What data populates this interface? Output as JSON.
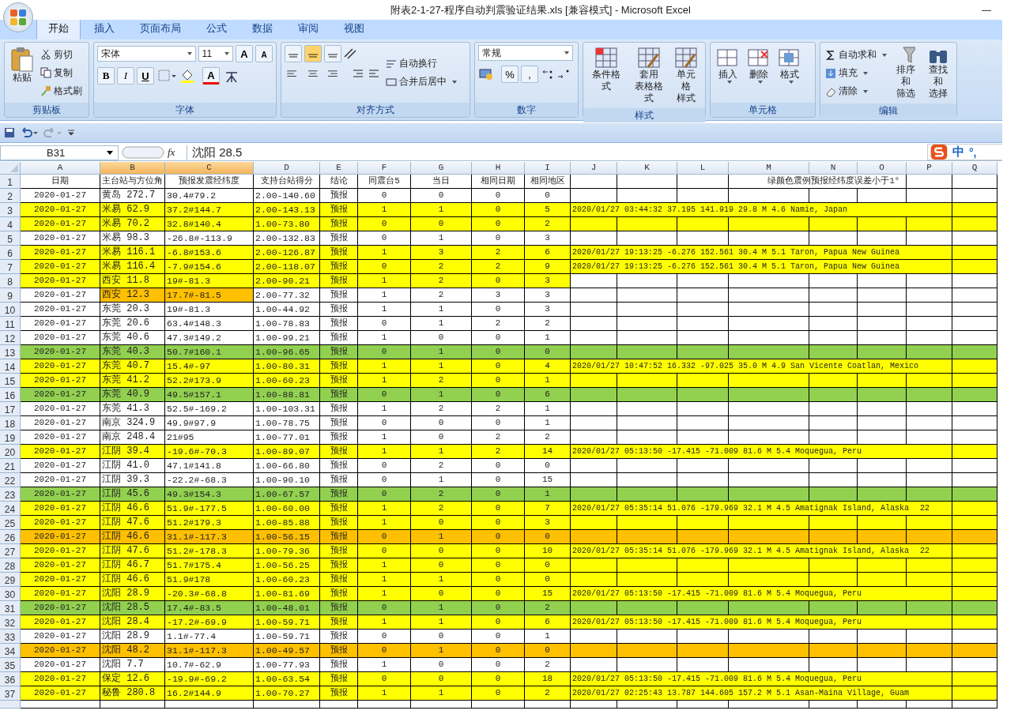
{
  "window": {
    "title": "附表2-1-27-程序自动判震验证结果.xls  [兼容模式] - Microsoft Excel",
    "minimize": "—"
  },
  "tabs": [
    {
      "label": "开始",
      "selected": true
    },
    {
      "label": "插入",
      "selected": false
    },
    {
      "label": "页面布局",
      "selected": false
    },
    {
      "label": "公式",
      "selected": false
    },
    {
      "label": "数据",
      "selected": false
    },
    {
      "label": "审阅",
      "selected": false
    },
    {
      "label": "视图",
      "selected": false
    }
  ],
  "ribbon": {
    "clipboard": {
      "label": "剪贴板",
      "paste": "粘贴",
      "small": [
        "剪切",
        "复制",
        "格式刷"
      ]
    },
    "font": {
      "label": "字体",
      "face": "宋体",
      "size": "11",
      "grow": "A",
      "shrink": "A",
      "styles": [
        "B",
        "I",
        "U"
      ],
      "color_letter": "A"
    },
    "alignment": {
      "label": "对齐方式",
      "valign": [
        {
          "selected": false
        },
        {
          "selected": true
        },
        {
          "selected": false
        }
      ],
      "wrap": "自动换行",
      "merge": "合并后居中"
    },
    "number": {
      "label": "数字",
      "format": "常规",
      "percent": "%",
      "comma": ","
    },
    "styles": {
      "label": "样式",
      "buttons": [
        [
          "条件格式"
        ],
        [
          "套用",
          "表格格式"
        ],
        [
          "单元格",
          "样式"
        ]
      ]
    },
    "cells": {
      "label": "单元格",
      "buttons": [
        "插入",
        "删除",
        "格式"
      ]
    },
    "editing": {
      "label": "编辑",
      "small": [
        "自动求和",
        "填充",
        "清除"
      ],
      "big": [
        [
          "排序和",
          "筛选"
        ],
        [
          "查找和",
          "选择"
        ]
      ]
    }
  },
  "formula_bar": {
    "name_box": "B31",
    "fx": "fx",
    "value": "沈阳 28.5"
  },
  "ime": {
    "mode": "中",
    "punct": "°,"
  },
  "columns": [
    {
      "letter": "A",
      "selected": false
    },
    {
      "letter": "B",
      "selected": true
    },
    {
      "letter": "C",
      "selected": true
    },
    {
      "letter": "D",
      "selected": false
    },
    {
      "letter": "E",
      "selected": false
    },
    {
      "letter": "F",
      "selected": false
    },
    {
      "letter": "G",
      "selected": false
    },
    {
      "letter": "H",
      "selected": false
    },
    {
      "letter": "I",
      "selected": false
    },
    {
      "letter": "J",
      "selected": false
    },
    {
      "letter": "K",
      "selected": false
    },
    {
      "letter": "L",
      "selected": false
    },
    {
      "letter": "M",
      "selected": false
    },
    {
      "letter": "N",
      "selected": false
    },
    {
      "letter": "O",
      "selected": false
    },
    {
      "letter": "P",
      "selected": false
    },
    {
      "letter": "Q",
      "selected": false
    }
  ],
  "header_row": {
    "num": "1",
    "cells": [
      "日期",
      "主台站与方位角",
      "预报发震经纬度",
      "支持台站得分",
      "结论",
      "同震台5",
      "当日",
      "相同日期",
      "相同地区"
    ],
    "note": "绿颜色震例预报经纬度误差小于1°"
  },
  "rows": [
    {
      "num": "2",
      "color": "#ffffff",
      "wide": false,
      "cells": [
        "2020-01-27",
        "黄岛 272.7",
        "30.4#79.2",
        "2.00-140.60",
        "预报",
        "0",
        "0",
        "0",
        "0"
      ]
    },
    {
      "num": "3",
      "color": "#ffff00",
      "wide": true,
      "cells": [
        "2020-01-27",
        "米易 62.9",
        "37.2#144.7",
        "2.00-143.13",
        "预报",
        "1",
        "1",
        "0",
        "5"
      ],
      "note": "2020/01/27 03:44:32 37.195 141.919 29.8 M 4.6 Namie, Japan"
    },
    {
      "num": "4",
      "color": "#ffff00",
      "wide": true,
      "cells": [
        "2020-01-27",
        "米易 70.2",
        "32.8#140.4",
        "1.00-73.80",
        "预报",
        "0",
        "0",
        "0",
        "2"
      ]
    },
    {
      "num": "5",
      "color": "#ffffff",
      "wide": false,
      "cells": [
        "2020-01-27",
        "米易 98.3",
        "-26.8#-113.9",
        "2.00-132.83",
        "预报",
        "0",
        "1",
        "0",
        "3"
      ]
    },
    {
      "num": "6",
      "color": "#ffff00",
      "wide": true,
      "cells": [
        "2020-01-27",
        "米易 116.1",
        "-6.8#153.6",
        "2.00-126.87",
        "预报",
        "1",
        "3",
        "2",
        "6"
      ],
      "note": "2020/01/27 19:13:25 -6.276 152.561 30.4 M 5.1 Taron, Papua New Guinea"
    },
    {
      "num": "7",
      "color": "#ffff00",
      "wide": true,
      "cells": [
        "2020-01-27",
        "米易 116.4",
        "-7.9#154.6",
        "2.00-118.07",
        "预报",
        "0",
        "2",
        "2",
        "9"
      ],
      "note": "2020/01/27 19:13:25 -6.276 152.561 30.4 M 5.1 Taron, Papua New Guinea"
    },
    {
      "num": "8",
      "color": "#ffff00",
      "wide": false,
      "cells": [
        "2020-01-27",
        "西安 11.8",
        "19#-81.3",
        "2.00-90.21",
        "预报",
        "1",
        "2",
        "0",
        "3"
      ]
    },
    {
      "num": "9",
      "color": "#ffffff",
      "wide": false,
      "cells": [
        "2020-01-27",
        {
          "text": "西安 12.3",
          "color": "#ffc000"
        },
        {
          "text": "17.7#-81.5",
          "color": "#ffc000"
        },
        "2.00-77.32",
        "预报",
        "1",
        "2",
        "3",
        "3"
      ]
    },
    {
      "num": "10",
      "color": "#ffffff",
      "wide": false,
      "cells": [
        "2020-01-27",
        "东莞 20.3",
        "19#-81.3",
        "1.00-44.92",
        "预报",
        "1",
        "1",
        "0",
        "3"
      ]
    },
    {
      "num": "11",
      "color": "#ffffff",
      "wide": false,
      "cells": [
        "2020-01-27",
        "东莞 20.6",
        "63.4#148.3",
        "1.00-78.83",
        "预报",
        "0",
        "1",
        "2",
        "2"
      ]
    },
    {
      "num": "12",
      "color": "#ffffff",
      "wide": false,
      "cells": [
        "2020-01-27",
        "东莞 40.6",
        "47.3#149.2",
        "1.00-99.21",
        "预报",
        "1",
        "0",
        "0",
        "1"
      ]
    },
    {
      "num": "13",
      "color": "#92d050",
      "wide": true,
      "cells": [
        "2020-01-27",
        "东莞 40.3",
        "50.7#160.1",
        "1.00-96.65",
        "预报",
        "0",
        "1",
        "0",
        "0"
      ]
    },
    {
      "num": "14",
      "color": "#ffff00",
      "wide": true,
      "cells": [
        "2020-01-27",
        "东莞 40.7",
        "15.4#-97",
        "1.00-80.31",
        "预报",
        "1",
        "1",
        "0",
        "4"
      ],
      "note": "2020/01/27 10:47:52 16.332 -97.025 35.0 M 4.9 San Vicente Coatlan, Mexico"
    },
    {
      "num": "15",
      "color": "#ffff00",
      "wide": true,
      "cells": [
        "2020-01-27",
        "东莞 41.2",
        "52.2#173.9",
        "1.00-60.23",
        "预报",
        "1",
        "2",
        "0",
        "1"
      ]
    },
    {
      "num": "16",
      "color": "#92d050",
      "wide": true,
      "cells": [
        "2020-01-27",
        "东莞 40.9",
        "49.5#157.1",
        "1.00-88.81",
        "预报",
        "0",
        "1",
        "0",
        "6"
      ]
    },
    {
      "num": "17",
      "color": "#ffffff",
      "wide": false,
      "cells": [
        "2020-01-27",
        "东莞 41.3",
        "52.5#-169.2",
        "1.00-103.31",
        "预报",
        "1",
        "2",
        "2",
        "1"
      ]
    },
    {
      "num": "18",
      "color": "#ffffff",
      "wide": false,
      "cells": [
        "2020-01-27",
        "南京 324.9",
        "49.9#97.9",
        "1.00-78.75",
        "预报",
        "0",
        "0",
        "0",
        "1"
      ]
    },
    {
      "num": "19",
      "color": "#ffffff",
      "wide": false,
      "cells": [
        "2020-01-27",
        "南京 248.4",
        "21#95",
        "1.00-77.01",
        "预报",
        "1",
        "0",
        "2",
        "2"
      ]
    },
    {
      "num": "20",
      "color": "#ffff00",
      "wide": true,
      "cells": [
        "2020-01-27",
        "江阴 39.4",
        "-19.6#-70.3",
        "1.00-89.07",
        "预报",
        "1",
        "1",
        "2",
        "14"
      ],
      "note": "2020/01/27 05:13:50 -17.415 -71.009 81.6 M 5.4 Moquegua, Peru"
    },
    {
      "num": "21",
      "color": "#ffffff",
      "wide": false,
      "cells": [
        "2020-01-27",
        "江阴 41.0",
        "47.1#141.8",
        "1.00-66.80",
        "预报",
        "0",
        "2",
        "0",
        "0"
      ]
    },
    {
      "num": "22",
      "color": "#ffffff",
      "wide": false,
      "cells": [
        "2020-01-27",
        "江阴 39.3",
        "-22.2#-68.3",
        "1.00-90.10",
        "预报",
        "0",
        "1",
        "0",
        "15"
      ]
    },
    {
      "num": "23",
      "color": "#92d050",
      "wide": true,
      "cells": [
        "2020-01-27",
        "江阴 45.6",
        "49.3#154.3",
        "1.00-67.57",
        "预报",
        "0",
        "2",
        "0",
        "1"
      ]
    },
    {
      "num": "24",
      "color": "#ffff00",
      "wide": true,
      "cells": [
        "2020-01-27",
        "江阴 46.6",
        "51.9#-177.5",
        "1.00-60.00",
        "预报",
        "1",
        "2",
        "0",
        "7"
      ],
      "note": "2020/01/27 05:35:14 51.076 -179.969 32.1 M 4.5 Amatignak Island, Alaska",
      "extra": "22"
    },
    {
      "num": "25",
      "color": "#ffff00",
      "wide": true,
      "cells": [
        "2020-01-27",
        "江阴 47.6",
        "51.2#179.3",
        "1.00-85.88",
        "预报",
        "1",
        "0",
        "0",
        "3"
      ]
    },
    {
      "num": "26",
      "color": "#ffc000",
      "wide": true,
      "cells": [
        "2020-01-27",
        "江阴 46.6",
        "31.1#-117.3",
        "1.00-56.15",
        "预报",
        "0",
        "1",
        "0",
        "0"
      ]
    },
    {
      "num": "27",
      "color": "#ffff00",
      "wide": true,
      "cells": [
        "2020-01-27",
        "江阴 47.6",
        "51.2#-178.3",
        "1.00-79.36",
        "预报",
        "0",
        "0",
        "0",
        "10"
      ],
      "note": "2020/01/27 05:35:14 51.076 -179.969 32.1 M 4.5 Amatignak Island, Alaska",
      "extra": "22"
    },
    {
      "num": "28",
      "color": "#ffff00",
      "wide": true,
      "cells": [
        "2020-01-27",
        "江阴 46.7",
        "51.7#175.4",
        "1.00-56.25",
        "预报",
        "1",
        "0",
        "0",
        "0"
      ]
    },
    {
      "num": "29",
      "color": "#ffff00",
      "wide": true,
      "cells": [
        "2020-01-27",
        "江阴 46.6",
        "51.9#178",
        "1.00-60.23",
        "预报",
        "1",
        "1",
        "0",
        "0"
      ]
    },
    {
      "num": "30",
      "color": "#ffff00",
      "wide": true,
      "cells": [
        "2020-01-27",
        "沈阳 28.9",
        "-20.3#-68.8",
        "1.00-81.69",
        "预报",
        "1",
        "0",
        "0",
        "15"
      ],
      "note": "2020/01/27 05:13:50 -17.415 -71.009 81.6 M 5.4 Moquegua, Peru"
    },
    {
      "num": "31",
      "color": "#92d050",
      "wide": true,
      "cells": [
        "2020-01-27",
        "沈阳 28.5",
        "17.4#-83.5",
        "1.00-48.01",
        "预报",
        "0",
        "1",
        "0",
        "2"
      ]
    },
    {
      "num": "32",
      "color": "#ffff00",
      "wide": true,
      "cells": [
        "2020-01-27",
        "沈阳 28.4",
        "-17.2#-69.9",
        "1.00-59.71",
        "预报",
        "1",
        "1",
        "0",
        "6"
      ],
      "note": "2020/01/27 05:13:50 -17.415 -71.009 81.6 M 5.4 Moquegua, Peru"
    },
    {
      "num": "33",
      "color": "#ffffff",
      "wide": false,
      "cells": [
        "2020-01-27",
        "沈阳 28.9",
        "1.1#-77.4",
        "1.00-59.71",
        "预报",
        "0",
        "0",
        "0",
        "1"
      ]
    },
    {
      "num": "34",
      "color": "#ffc000",
      "wide": true,
      "cells": [
        "2020-01-27",
        "沈阳 48.2",
        "31.1#-117.3",
        "1.00-49.57",
        "预报",
        "0",
        "1",
        "0",
        "0"
      ]
    },
    {
      "num": "35",
      "color": "#ffffff",
      "wide": false,
      "cells": [
        "2020-01-27",
        "沈阳 7.7",
        "10.7#-62.9",
        "1.00-77.93",
        "预报",
        "1",
        "0",
        "0",
        "2"
      ]
    },
    {
      "num": "36",
      "color": "#ffff00",
      "wide": true,
      "cells": [
        "2020-01-27",
        "保定 12.6",
        "-19.9#-69.2",
        "1.00-63.54",
        "预报",
        "0",
        "0",
        "0",
        "18"
      ],
      "note": "2020/01/27 05:13:50 -17.415 -71.009 81.6 M 5.4 Moquegua, Peru"
    },
    {
      "num": "37",
      "color": "#ffff00",
      "wide": true,
      "cells": [
        "2020-01-27",
        "秘鲁 280.8",
        "16.2#144.9",
        "1.00-70.27",
        "预报",
        "1",
        "1",
        "0",
        "2"
      ],
      "note": "2020/01/27 02:25:43 13.787 144.605 157.2 M 5.1 Asan-Maina Village, Guam"
    }
  ]
}
